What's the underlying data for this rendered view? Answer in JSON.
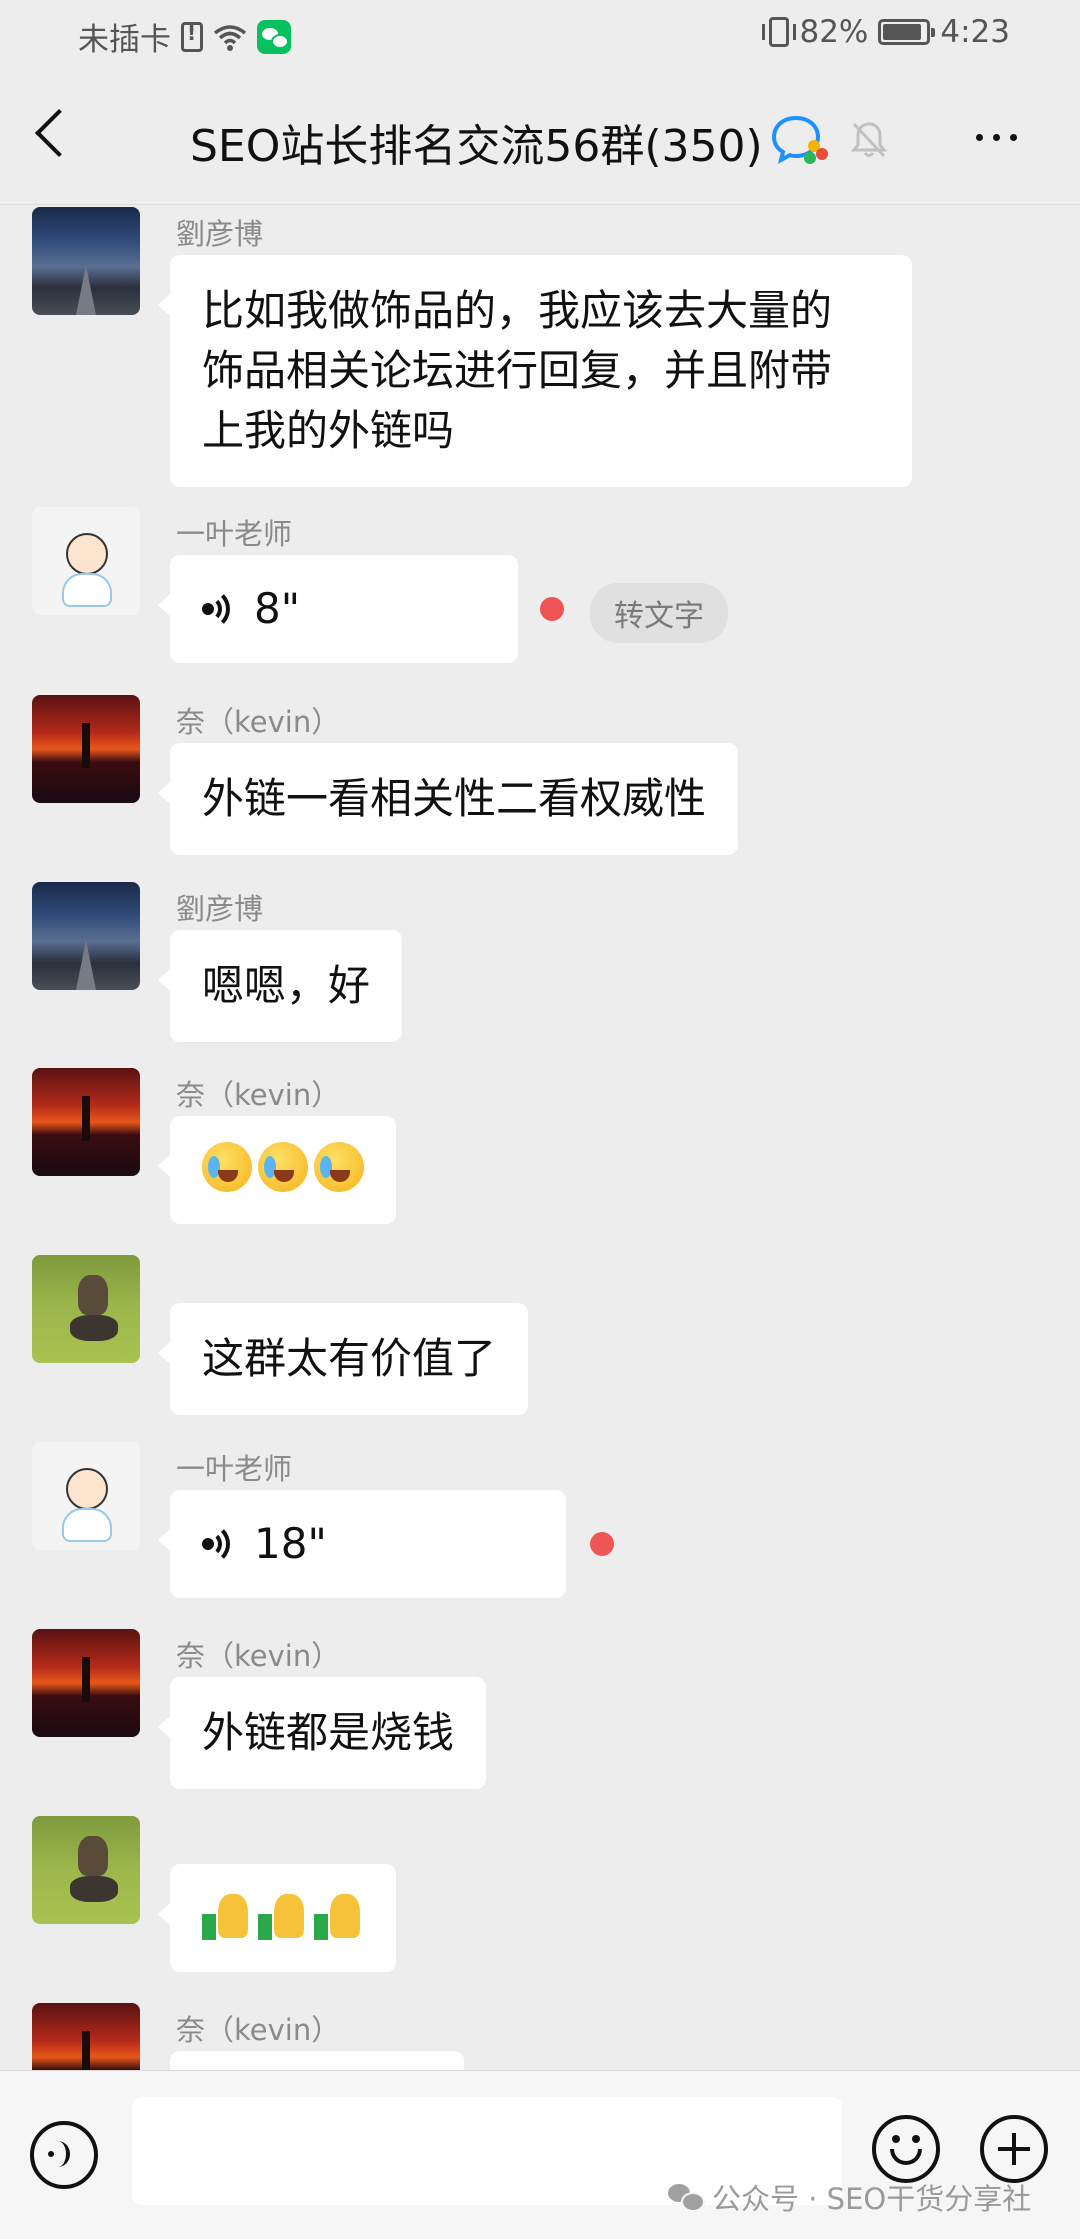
{
  "status_bar": {
    "carrier": "未插卡",
    "battery": "82%",
    "time": "4:23"
  },
  "header": {
    "title": "SEO站长排名交流56群(350)"
  },
  "messages": [
    {
      "sender": "劉彦博",
      "text_lines": [
        "比如我做饰品的，我应该去大量的",
        "饰品相关论坛进行回复，并且附带",
        "上我的外链吗"
      ]
    },
    {
      "sender": "一叶老师",
      "voice_duration": "8\"",
      "to_text": "转文字"
    },
    {
      "sender": "奈（kevin）",
      "text": "外链一看相关性二看权威性"
    },
    {
      "sender": "劉彦博",
      "text": "嗯嗯，好"
    },
    {
      "sender": "奈（kevin）",
      "emoji": [
        "crying-laughing",
        "crying-laughing",
        "crying-laughing"
      ]
    },
    {
      "sender": "",
      "text": "这群太有价值了"
    },
    {
      "sender": "一叶老师",
      "voice_duration": "18\""
    },
    {
      "sender": "奈（kevin）",
      "text": "外链都是烧钱"
    },
    {
      "sender": "",
      "emoji": [
        "thumbs-up",
        "thumbs-up",
        "thumbs-up"
      ]
    },
    {
      "sender": "奈（kevin）"
    }
  ],
  "watermark": "公众号 · SEO干货分享社",
  "colors": {
    "background": "#ededed",
    "bubble": "#ffffff",
    "unread_dot": "#f05555",
    "input_bar": "#f6f6f6"
  }
}
